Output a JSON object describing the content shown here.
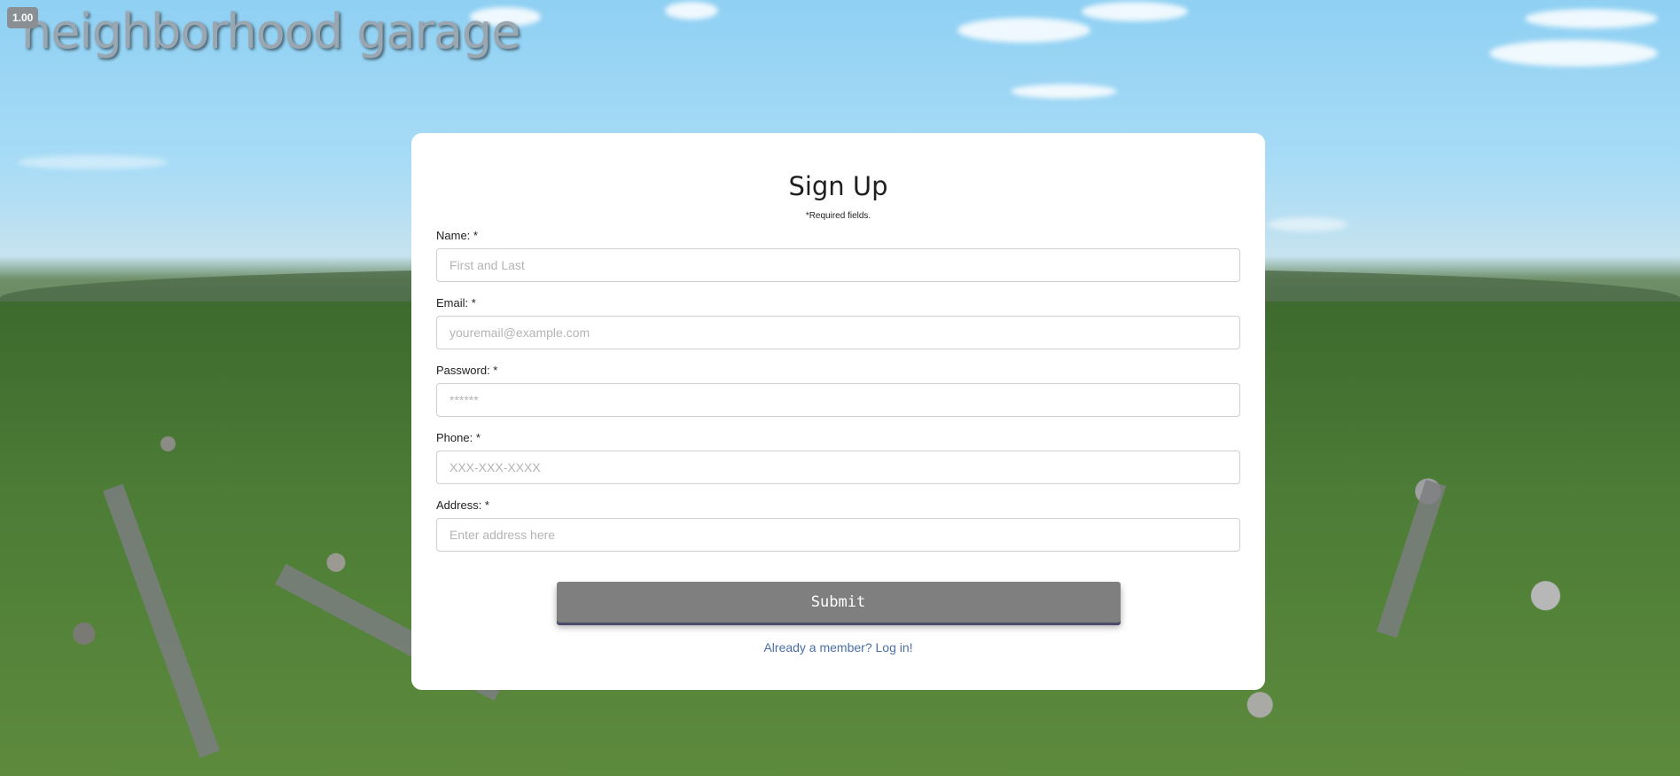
{
  "header": {
    "logo_text": "neighborhood garage",
    "zoom_badge": "1.00"
  },
  "form": {
    "title": "Sign Up",
    "required_note": "*Required fields.",
    "fields": [
      {
        "label": "Name: *",
        "placeholder": "First and Last",
        "value": ""
      },
      {
        "label": "Email: *",
        "placeholder": "youremail@example.com",
        "value": ""
      },
      {
        "label": "Password: *",
        "placeholder": "******",
        "value": ""
      },
      {
        "label": "Phone: *",
        "placeholder": "XXX-XXX-XXXX",
        "value": ""
      },
      {
        "label": "Address: *",
        "placeholder": "Enter address here",
        "value": ""
      }
    ],
    "submit_label": "Submit",
    "login_link": "Already a member? Log in!"
  },
  "colors": {
    "submit_bg": "#7f7f7f",
    "link": "#4a6fa5",
    "logo": "#9aa6b0"
  }
}
